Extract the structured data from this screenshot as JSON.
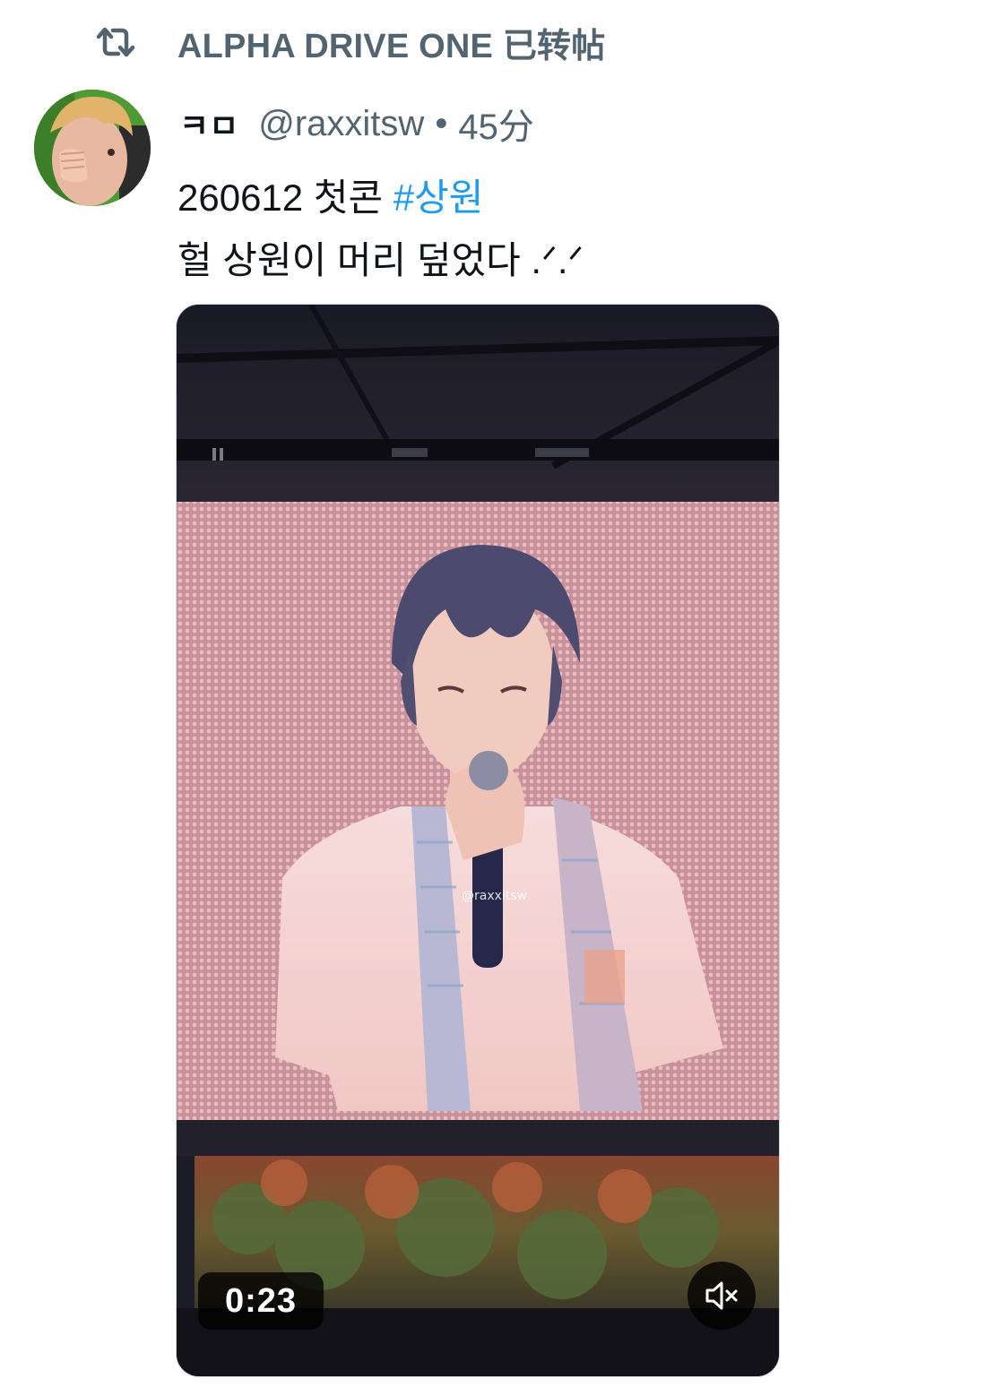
{
  "retweet": {
    "label": "ALPHA DRIVE ONE 已转帖",
    "icon": "retweet-icon"
  },
  "tweet": {
    "display_name": "ㅋㅁ",
    "handle": "@raxxitsw",
    "separator": "•",
    "time": "45分",
    "line1_prefix": "260612 첫콘 ",
    "hashtag": "#상원",
    "line2": "헐 상원이 머리 덮었다 .ᐟ.ᐟ",
    "colors": {
      "hashtag": "#1d9bf0",
      "secondary_text": "#536471",
      "primary_text": "#0f1419"
    }
  },
  "video": {
    "duration": "0:23",
    "watermark": "@raxxitsw",
    "mute_icon": "volume-muted-icon",
    "progress": 0
  }
}
